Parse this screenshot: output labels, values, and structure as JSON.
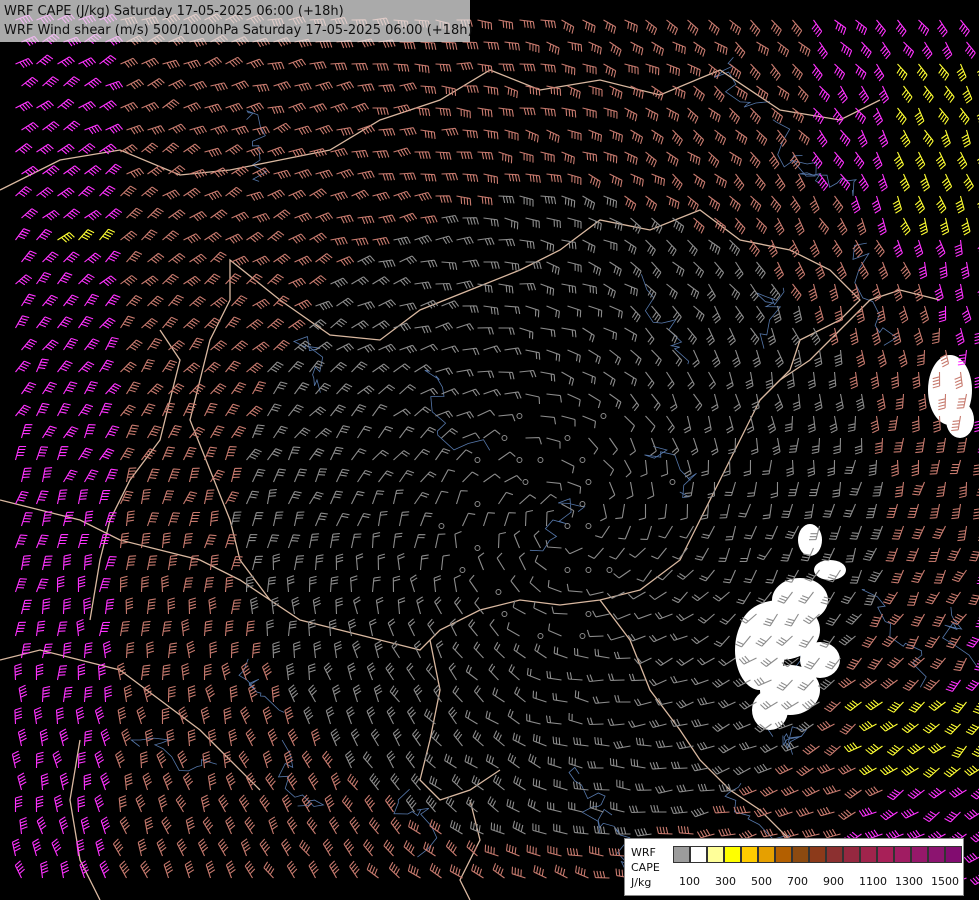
{
  "title": {
    "line1": "WRF CAPE (J/kg) Saturday 17-05-2025 06:00 (+18h)",
    "line2": "WRF Wind shear (m/s) 500/1000hPa Saturday 17-05-2025 06:00 (+18h)"
  },
  "legend": {
    "line1": "WRF",
    "line2": "CAPE",
    "line3": "J/kg",
    "swatch_colors": [
      "#9c9c9c",
      "#ffffff",
      "#ffff99",
      "#ffff00",
      "#ffcc00",
      "#e6a000",
      "#b35f00",
      "#8c4a10",
      "#8c3a1a",
      "#8c3030",
      "#962840",
      "#a0244c",
      "#a82058",
      "#a01c62",
      "#96186a",
      "#8c1470",
      "#820c70"
    ],
    "tick_labels": [
      "100",
      "300",
      "500",
      "700",
      "900",
      "1100",
      "1300",
      "1500"
    ]
  },
  "colors": {
    "background": "#000000",
    "barb_low": "#8c8c8c",
    "barb_mid": "#c77a6e",
    "barb_high": "#ff33ff",
    "barb_extreme": "#ffff33",
    "border": "#d9b8a0",
    "river": "#5577aa",
    "cape_patch": "#ffffff"
  }
}
